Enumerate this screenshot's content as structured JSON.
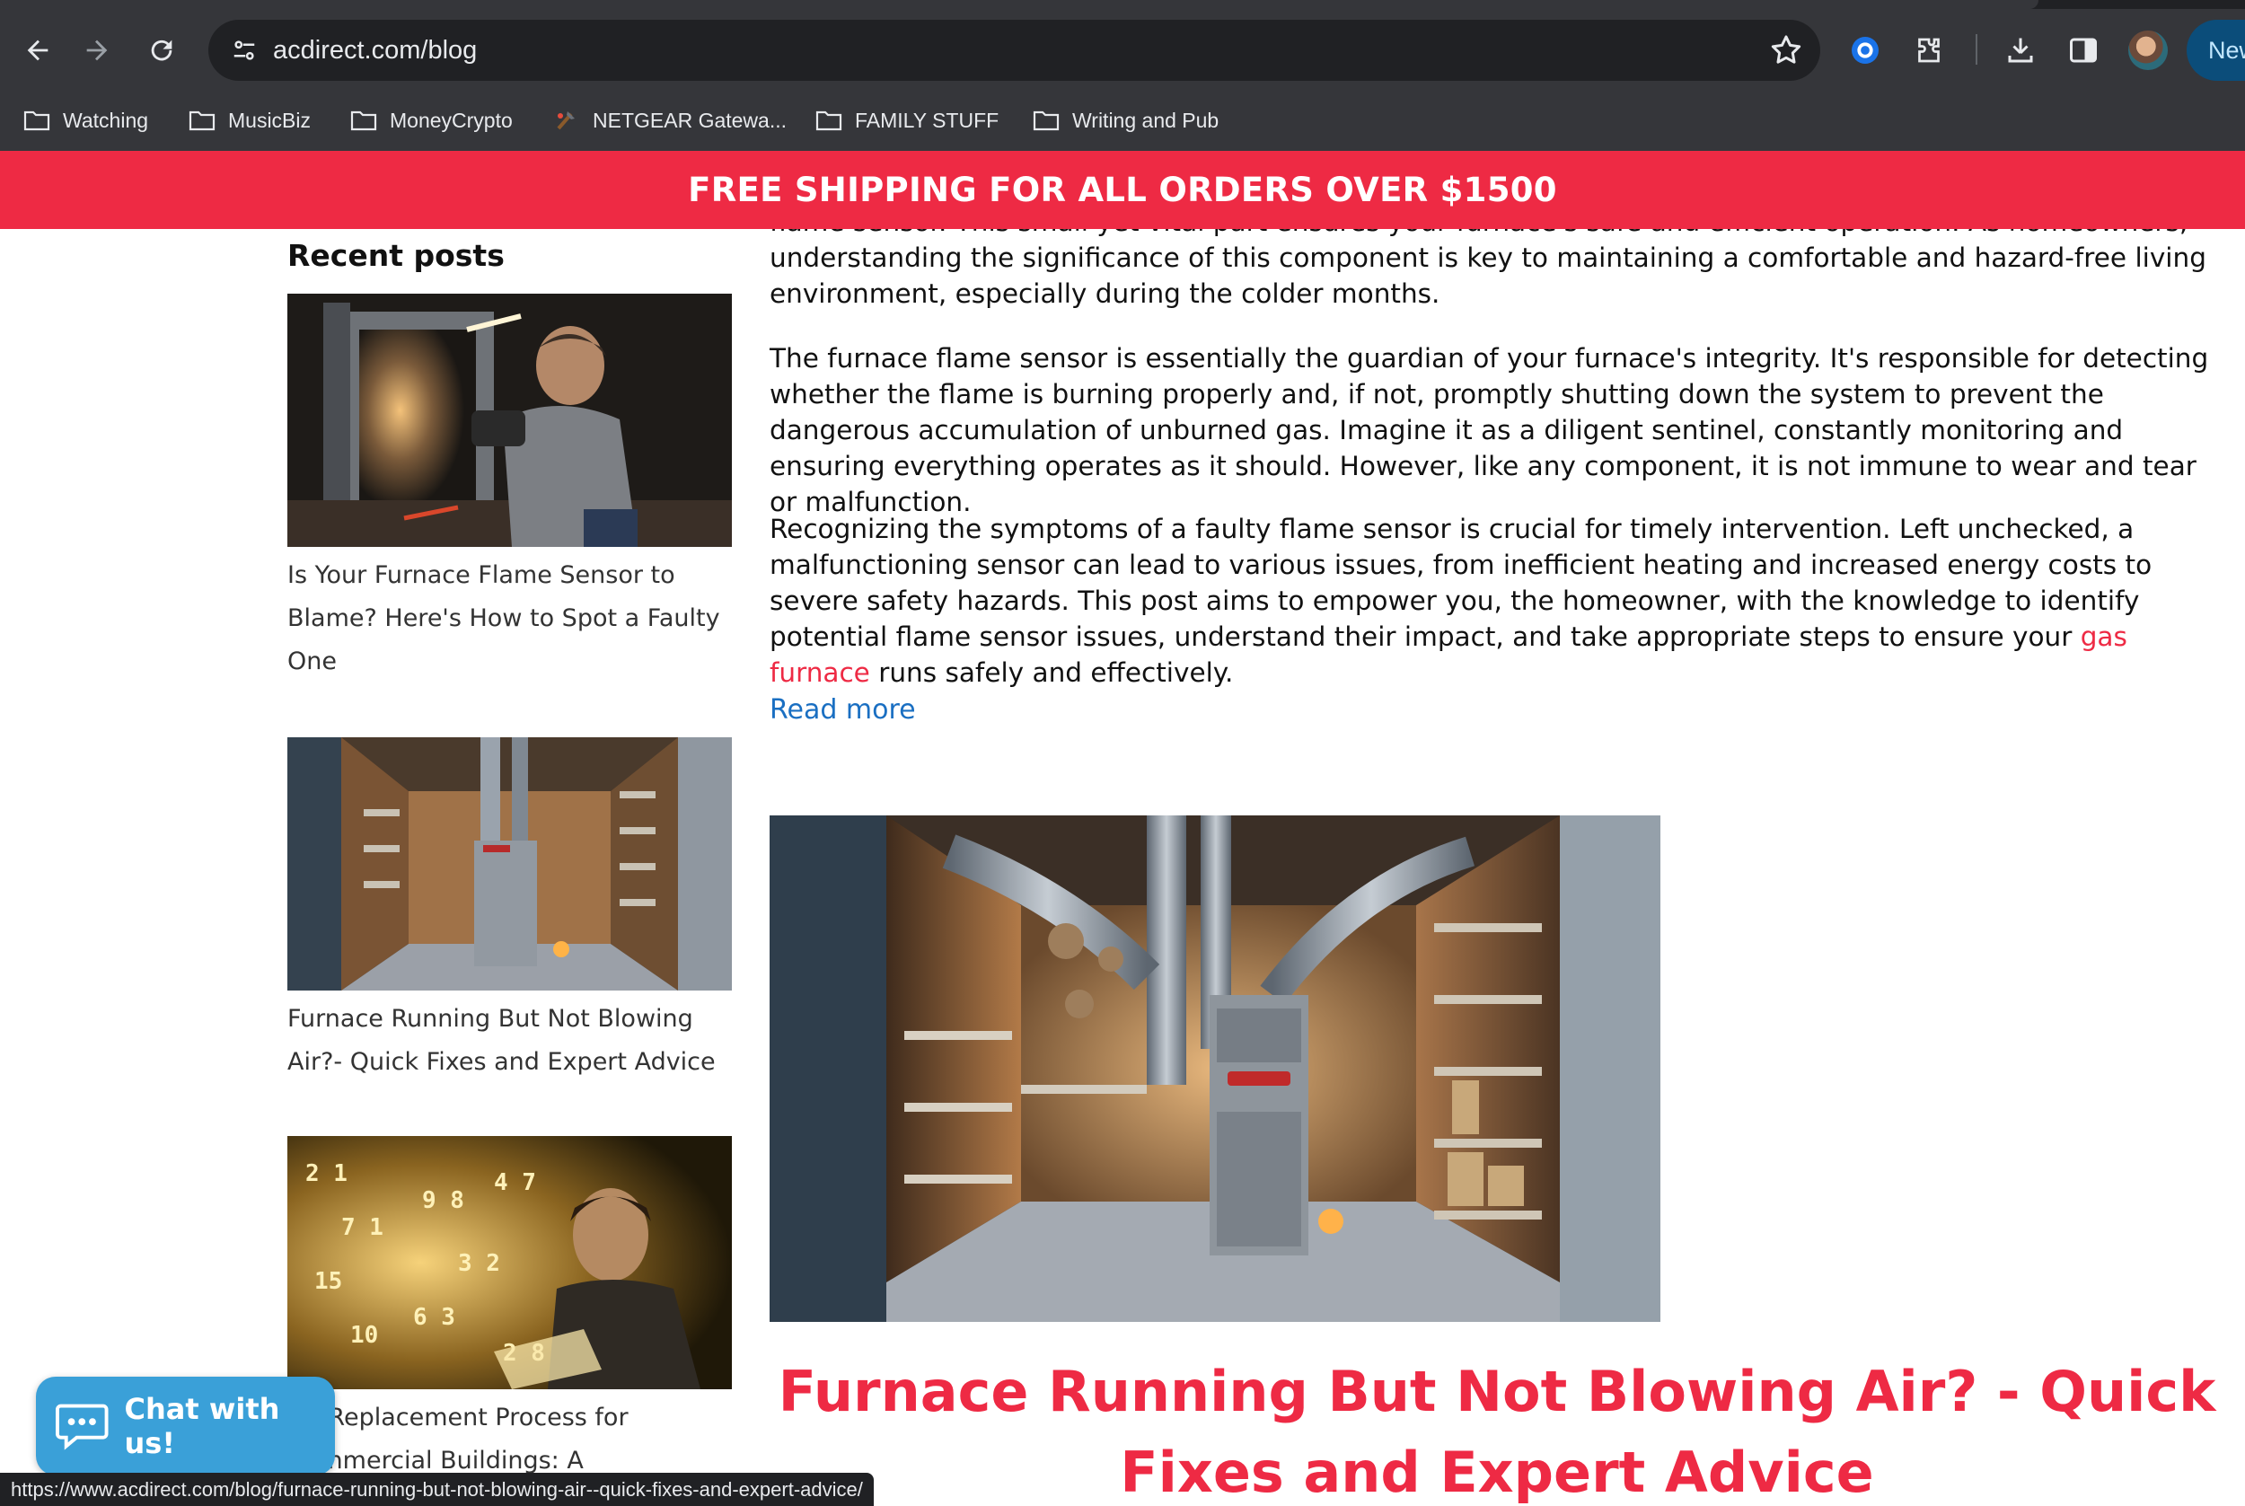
{
  "browser": {
    "url": "acdirect.com/blog",
    "new_button_label": "New",
    "bookmarks": [
      {
        "label": "Watching",
        "icon": "folder-icon"
      },
      {
        "label": "MusicBiz",
        "icon": "folder-icon"
      },
      {
        "label": "MoneyCrypto",
        "icon": "folder-icon"
      },
      {
        "label": "NETGEAR Gatewa...",
        "icon": "netgear-favicon-icon"
      },
      {
        "label": "FAMILY STUFF",
        "icon": "folder-icon"
      },
      {
        "label": "Writing and Pub",
        "icon": "folder-icon"
      }
    ],
    "status_url": "https://www.acdirect.com/blog/furnace-running-but-not-blowing-air--quick-fixes-and-expert-advice/"
  },
  "promo": {
    "text": "FREE SHIPPING FOR ALL ORDERS OVER $1500",
    "color": "#ee2a44"
  },
  "sidebar": {
    "heading": "Recent posts",
    "posts": [
      {
        "title": "Is Your Furnace Flame Sensor to Blame? Here's How to Spot a Faulty One"
      },
      {
        "title": "Furnace Running But Not Blowing Air?- Quick Fixes and Expert Advice"
      },
      {
        "title": "AC Replacement Process for Commercial Buildings: A"
      }
    ]
  },
  "article": {
    "partial_top_line": "flame sensor. This small yet vital part ensures your furnace's safe and efficient operation. As homeowners,",
    "paragraph1": "understanding the significance of this component is key to maintaining a comfortable and hazard-free living environment, especially during the colder months.",
    "paragraph2": "The furnace flame sensor is essentially the guardian of your furnace's integrity. It's responsible for detecting whether the flame is burning properly and, if not, promptly shutting down the system to prevent the dangerous accumulation of unburned gas. Imagine it as a diligent sentinel, constantly monitoring and ensuring everything operates as it should. However, like any component, it is not immune to wear and tear or malfunction.",
    "paragraph3_before_link": "Recognizing the symptoms of a faulty flame sensor is crucial for timely intervention. Left unchecked, a malfunctioning sensor can lead to various issues, from inefficient heating and increased energy costs to severe safety hazards. This post aims to empower you, the homeowner, with the knowledge to identify potential flame sensor issues, understand their impact, and take appropriate steps to ensure your ",
    "paragraph3_link": "gas furnace",
    "paragraph3_after_link": " runs safely and effectively.",
    "read_more": "Read more",
    "next_title": "Furnace Running But Not Blowing Air? - Quick Fixes and Expert Advice",
    "link_color": "#1a6fc2"
  },
  "chat": {
    "label": "Chat with us!",
    "color": "#3aa0d8"
  }
}
